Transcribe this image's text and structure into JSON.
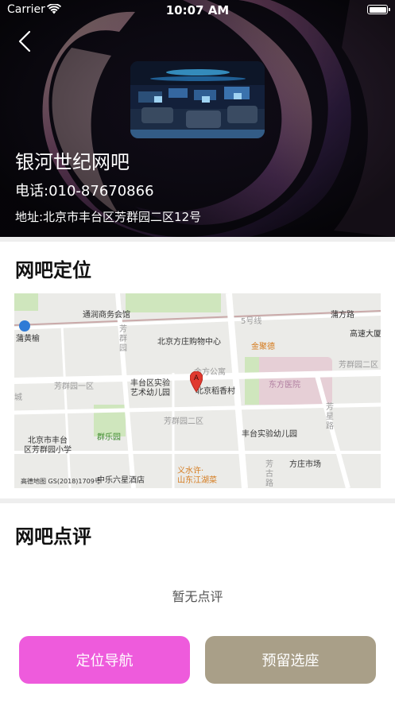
{
  "status_bar": {
    "carrier": "Carrier",
    "time": "10:07 AM"
  },
  "cafe": {
    "name": "银河世纪网吧",
    "phone": "电话:010-87670866",
    "address": "地址:北京市丰台区芳群园二区12号"
  },
  "location_section": {
    "title": "网吧定位",
    "map_labels": {
      "tongrun": "通润商务会馆",
      "puhuang": "蒲黄榆",
      "fangqun_vertical": "芳\n群\n园",
      "fangzhuang_mall": "北京方庄购物中心",
      "jinju": "金聚德",
      "pufang_road": "蒲方路",
      "gaosu": "高速大厦",
      "line5": "5号线",
      "jinfang": "金方公寓",
      "fangqun_2_right": "芳群园二区",
      "dongfang_hospital": "东方医院",
      "fangqun_1": "芳群园一区",
      "fengtai_kindergarten": "丰台区实验\n艺术幼儿园",
      "daoxiangcun": "北京稻香村",
      "fangqun_2": "芳群园二区",
      "fengtai_kindergarten_2": "丰台实验幼儿园",
      "fangxing_road": "芳星路",
      "cheng": "城",
      "fengtai_school": "北京市丰台\n区芳群园小学",
      "qunle": "群乐园",
      "fangzhuang_market": "方庄市场",
      "fangzhuang_road": "芳古路",
      "zhongle_hotel": "中乐六星酒店",
      "yishui": "义水许·\n山东江湖菜",
      "attribution": "高德地图  GS(2018)1709号",
      "marker": "A"
    }
  },
  "review_section": {
    "title": "网吧点评",
    "empty_text": "暂无点评"
  },
  "actions": {
    "navigate_label": "定位导航",
    "reserve_label": "预留选座"
  },
  "colors": {
    "navigate_button": "#ee5bdc",
    "reserve_button": "#a99f88",
    "hero_background": "#0b0a10"
  }
}
